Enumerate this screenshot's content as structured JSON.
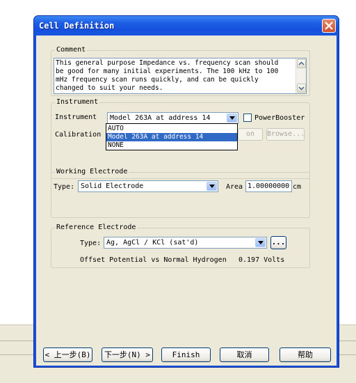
{
  "window": {
    "title": "Cell Definition"
  },
  "comment": {
    "label": "Comment",
    "text_lines": [
      "This general purpose Impedance vs. frequency scan should",
      "be good for many initial experiments.  The 100 kHz to 100",
      "mHz frequency scan runs quickly, and can be quickly",
      "changed to suit your needs."
    ]
  },
  "instrument": {
    "group_label": "Instrument",
    "instrument_label": "Instrument",
    "selected": "Model 263A at address 14",
    "powerbooster_label": "PowerBooster",
    "calibration_label": "Calibration I",
    "calibration_button_label": "on",
    "browse_label": "Browse...",
    "options": [
      "AUTO",
      "Model 263A at address 14",
      "NONE"
    ],
    "selected_index": 1
  },
  "working_electrode": {
    "group_label": "Working Electrode",
    "type_label": "Type:",
    "type_value": "Solid Electrode",
    "area_label": "Area",
    "area_value": "1.00000000",
    "area_unit": "cm"
  },
  "reference_electrode": {
    "group_label": "Reference Electrode",
    "type_label": "Type:",
    "type_value": "Ag, AgCl / KCl (sat'd)",
    "more_label": "...",
    "offset_label": "Offset Potential vs Normal Hydrogen",
    "offset_value": "0.197 Volts"
  },
  "buttons": {
    "back": "< 上一步(B)",
    "next": "下一步(N) >",
    "finish": "Finish",
    "cancel": "取消",
    "help": "帮助"
  },
  "colors": {
    "titlebar": "#1e5fe6",
    "selection": "#316ac5",
    "dialog_bg": "#ece9d8",
    "close": "#d0512d"
  }
}
